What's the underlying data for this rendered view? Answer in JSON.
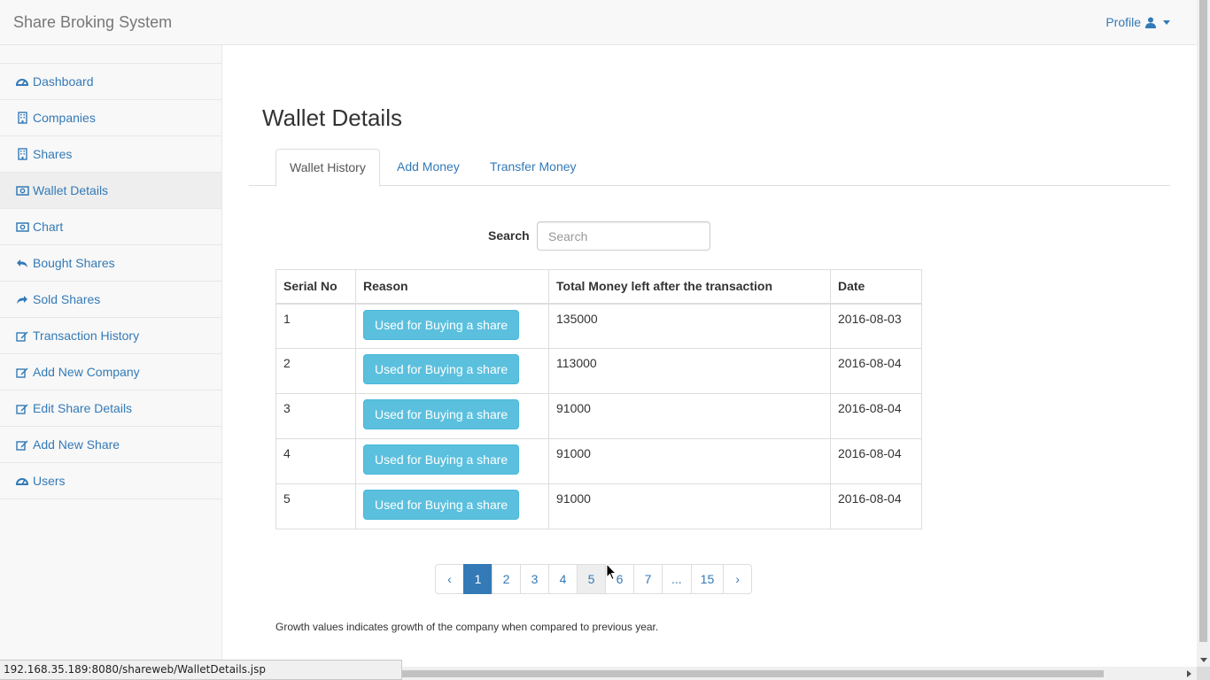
{
  "navbar": {
    "brand": "Share Broking System",
    "profile_label": "Profile"
  },
  "sidebar": {
    "items": [
      {
        "label": "Dashboard",
        "icon": "dashboard-icon",
        "active": false
      },
      {
        "label": "Companies",
        "icon": "building-icon",
        "active": false
      },
      {
        "label": "Shares",
        "icon": "building-icon",
        "active": false
      },
      {
        "label": "Wallet Details",
        "icon": "money-icon",
        "active": true
      },
      {
        "label": "Chart",
        "icon": "money-icon",
        "active": false
      },
      {
        "label": "Bought Shares",
        "icon": "reply-icon",
        "active": false
      },
      {
        "label": "Sold Shares",
        "icon": "share-icon",
        "active": false
      },
      {
        "label": "Transaction History",
        "icon": "edit-icon",
        "active": false
      },
      {
        "label": "Add New Company",
        "icon": "edit-icon",
        "active": false
      },
      {
        "label": "Edit Share Details",
        "icon": "edit-icon",
        "active": false
      },
      {
        "label": "Add New Share",
        "icon": "edit-icon",
        "active": false
      },
      {
        "label": "Users",
        "icon": "dashboard-icon",
        "active": false
      }
    ]
  },
  "main": {
    "title": "Wallet Details",
    "tabs": [
      {
        "label": "Wallet History",
        "active": true
      },
      {
        "label": "Add Money",
        "active": false
      },
      {
        "label": "Transfer Money",
        "active": false
      }
    ],
    "search": {
      "label": "Search",
      "placeholder": "Search"
    }
  },
  "table": {
    "headers": [
      "Serial No",
      "Reason",
      "Total Money left after the transaction",
      "Date"
    ],
    "rows": [
      {
        "serial": "1",
        "reason": "Used for Buying a share",
        "money": "135000",
        "date": "2016-08-03"
      },
      {
        "serial": "2",
        "reason": "Used for Buying a share",
        "money": "113000",
        "date": "2016-08-04"
      },
      {
        "serial": "3",
        "reason": "Used for Buying a share",
        "money": "91000",
        "date": "2016-08-04"
      },
      {
        "serial": "4",
        "reason": "Used for Buying a share",
        "money": "91000",
        "date": "2016-08-04"
      },
      {
        "serial": "5",
        "reason": "Used for Buying a share",
        "money": "91000",
        "date": "2016-08-04"
      }
    ]
  },
  "pagination": {
    "prev": "‹",
    "pages": [
      "1",
      "2",
      "3",
      "4",
      "5",
      "6",
      "7",
      "...",
      "15"
    ],
    "next": "›",
    "current": "1",
    "hovered": "5"
  },
  "note": "Growth values indicates growth of the company when compared to previous year.",
  "statusbar": {
    "url": "192.168.35.189:8080/shareweb/WalletDetails.jsp"
  },
  "colors": {
    "link": "#337ab7",
    "info_button": "#5bc0de",
    "active_page": "#337ab7"
  }
}
